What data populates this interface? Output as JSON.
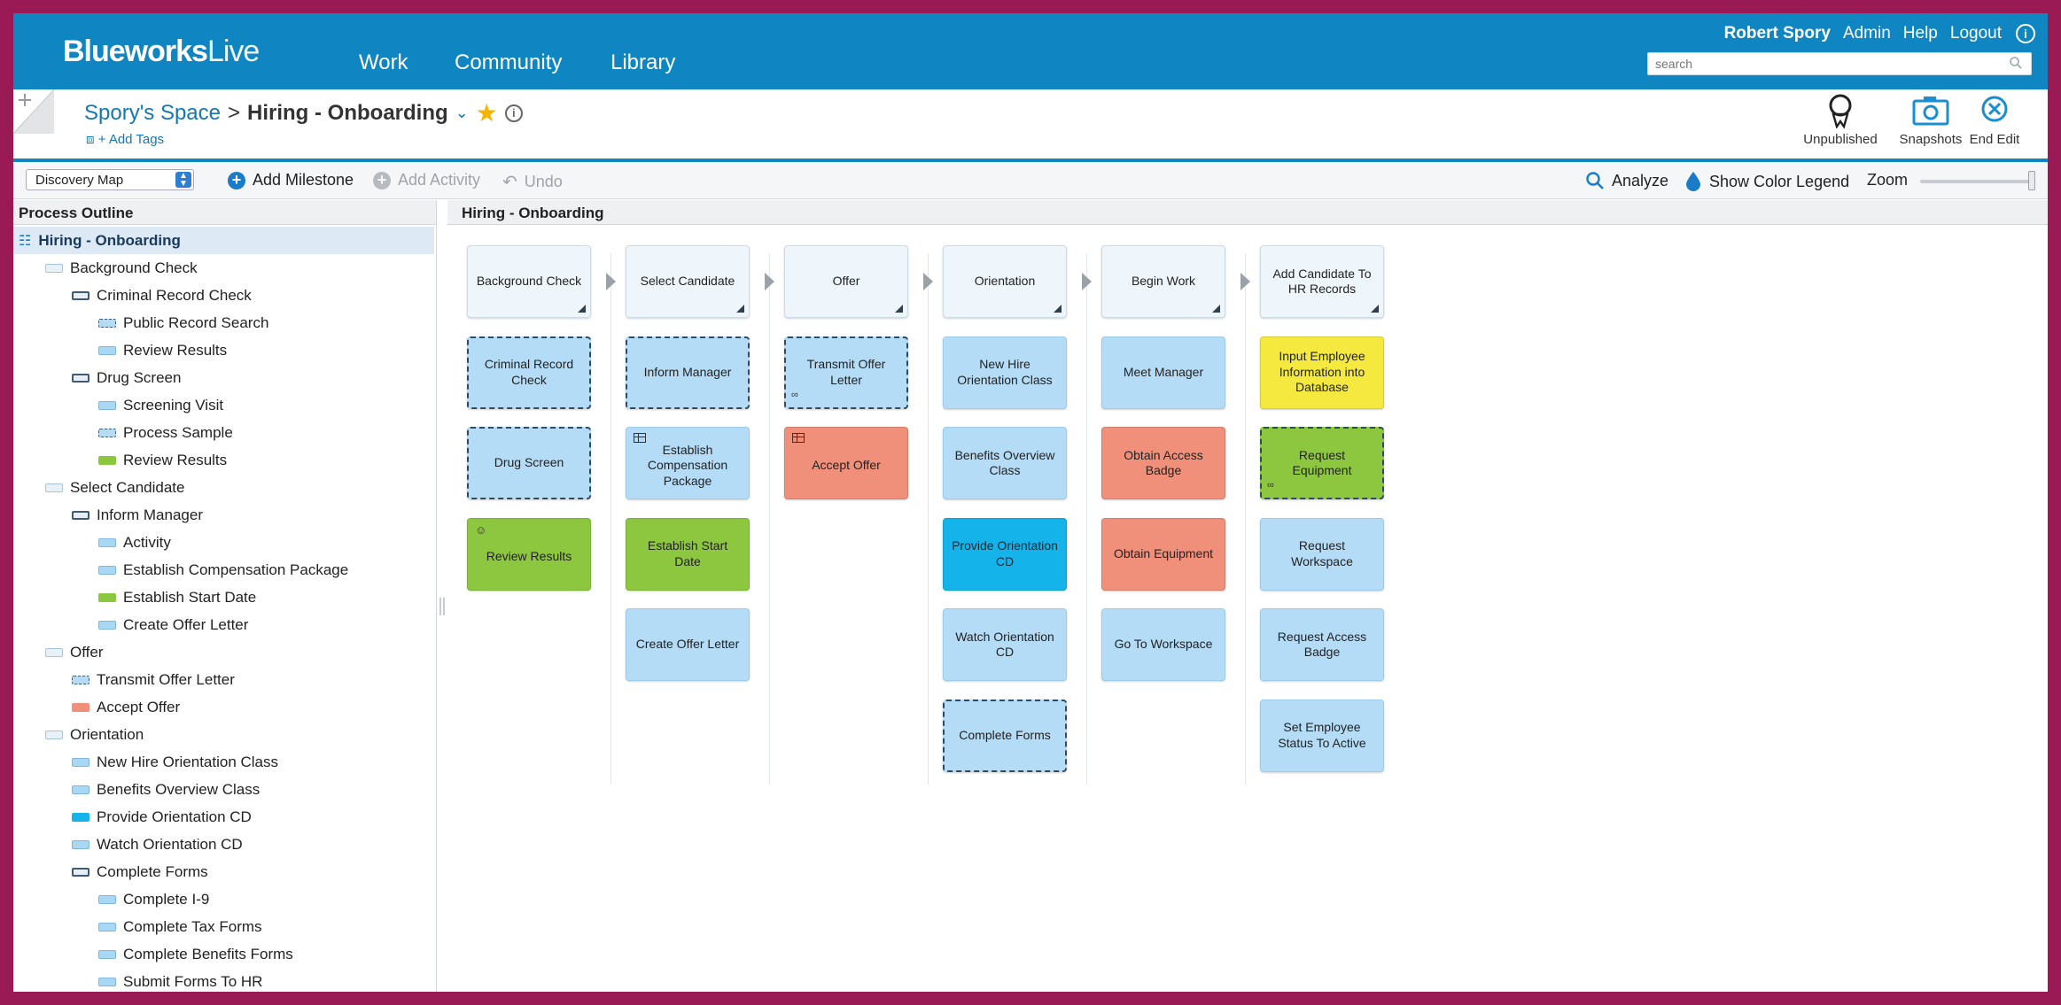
{
  "header": {
    "logo_bold": "Blueworks",
    "logo_light": "Live",
    "nav": [
      "Work",
      "Community",
      "Library"
    ],
    "user_name": "Robert Spory",
    "links": [
      "Admin",
      "Help",
      "Logout"
    ],
    "info_glyph": "i",
    "search_placeholder": "search"
  },
  "titlebar": {
    "space": "Spory's Space",
    "separator": ">",
    "current": "Hiring - Onboarding",
    "add_tags": "+ Add Tags",
    "actions": {
      "unpublished": "Unpublished",
      "snapshots": "Snapshots",
      "end_edit": "End Edit"
    }
  },
  "toolbar": {
    "view": "Discovery Map",
    "add_milestone": "Add Milestone",
    "add_activity": "Add Activity",
    "undo": "Undo",
    "analyze": "Analyze",
    "color_legend": "Show Color Legend",
    "zoom": "Zoom"
  },
  "outline": {
    "title": "Process Outline",
    "items": [
      {
        "label": "Hiring - Onboarding",
        "type": "root"
      },
      {
        "label": "Background Check",
        "type": "milestone"
      },
      {
        "label": "Criminal Record Check",
        "type": "sub"
      },
      {
        "label": "Public Record Search",
        "type": "dashed"
      },
      {
        "label": "Review Results",
        "type": "activity"
      },
      {
        "label": "Drug Screen",
        "type": "sub"
      },
      {
        "label": "Screening Visit",
        "type": "activity"
      },
      {
        "label": "Process Sample",
        "type": "dashed"
      },
      {
        "label": "Review Results",
        "type": "green"
      },
      {
        "label": "Select Candidate",
        "type": "milestone"
      },
      {
        "label": "Inform Manager",
        "type": "sub"
      },
      {
        "label": "Activity",
        "type": "activity"
      },
      {
        "label": "Establish Compensation Package",
        "type": "activity"
      },
      {
        "label": "Establish Start Date",
        "type": "green"
      },
      {
        "label": "Create Offer Letter",
        "type": "activity"
      },
      {
        "label": "Offer",
        "type": "milestone"
      },
      {
        "label": "Transmit Offer Letter",
        "type": "dashed"
      },
      {
        "label": "Accept Offer",
        "type": "salmon"
      },
      {
        "label": "Orientation",
        "type": "milestone"
      },
      {
        "label": "New Hire Orientation Class",
        "type": "activity"
      },
      {
        "label": "Benefits Overview Class",
        "type": "activity"
      },
      {
        "label": "Provide Orientation CD",
        "type": "cyan"
      },
      {
        "label": "Watch Orientation CD",
        "type": "activity"
      },
      {
        "label": "Complete Forms",
        "type": "sub"
      },
      {
        "label": "Complete I-9",
        "type": "activity"
      },
      {
        "label": "Complete Tax Forms",
        "type": "activity"
      },
      {
        "label": "Complete Benefits Forms",
        "type": "activity"
      },
      {
        "label": "Submit Forms To HR",
        "type": "activity"
      }
    ]
  },
  "map": {
    "title": "Hiring - Onboarding",
    "colors": {
      "green": "#8dc63f",
      "salmon": "#f0907a",
      "cyan": "#14b4ea",
      "yellow": "#f5e940",
      "activity": "#b4dcf6",
      "milestone": "#eef5fb"
    },
    "columns": [
      {
        "milestone": "Background Check",
        "cards": [
          {
            "label": "Criminal Record Check",
            "style": "activity",
            "dashed": true
          },
          {
            "label": "Drug Screen",
            "style": "activity",
            "dashed": true
          },
          {
            "label": "Review Results",
            "style": "green",
            "icon": "person"
          }
        ]
      },
      {
        "milestone": "Select Candidate",
        "cards": [
          {
            "label": "Inform Manager",
            "style": "activity",
            "dashed": true
          },
          {
            "label": "Establish Compensation Package",
            "style": "activity",
            "icon": "table"
          },
          {
            "label": "Establish Start Date",
            "style": "green"
          },
          {
            "label": "Create Offer Letter",
            "style": "activity"
          }
        ]
      },
      {
        "milestone": "Offer",
        "cards": [
          {
            "label": "Transmit Offer Letter",
            "style": "activity",
            "dashed": true,
            "icon": "link"
          },
          {
            "label": "Accept Offer",
            "style": "salmon",
            "icon": "table"
          }
        ]
      },
      {
        "milestone": "Orientation",
        "cards": [
          {
            "label": "New Hire Orientation Class",
            "style": "activity"
          },
          {
            "label": "Benefits Overview Class",
            "style": "activity"
          },
          {
            "label": "Provide Orientation CD",
            "style": "cyan"
          },
          {
            "label": "Watch Orientation CD",
            "style": "activity"
          },
          {
            "label": "Complete Forms",
            "style": "activity",
            "dashed": true
          }
        ]
      },
      {
        "milestone": "Begin Work",
        "cards": [
          {
            "label": "Meet Manager",
            "style": "activity"
          },
          {
            "label": "Obtain Access Badge",
            "style": "salmon"
          },
          {
            "label": "Obtain Equipment",
            "style": "salmon"
          },
          {
            "label": "Go To Workspace",
            "style": "activity"
          }
        ]
      },
      {
        "milestone": "Add Candidate To HR Records",
        "cards": [
          {
            "label": "Input Employee Information into Database",
            "style": "yellow"
          },
          {
            "label": "Request Equipment",
            "style": "green",
            "dashed": true,
            "icon": "link"
          },
          {
            "label": "Request Workspace",
            "style": "activity"
          },
          {
            "label": "Request Access Badge",
            "style": "activity"
          },
          {
            "label": "Set Employee Status To Active",
            "style": "activity"
          }
        ]
      }
    ]
  }
}
